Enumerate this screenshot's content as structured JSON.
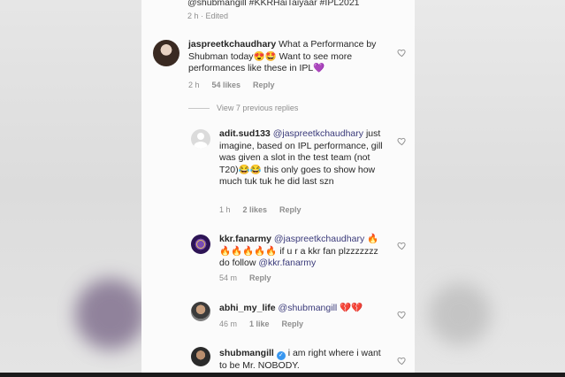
{
  "top": {
    "caption_tail": "@shubmangill #KKRHaiTaiyaar #IPL2021",
    "meta": "2 h · Edited"
  },
  "comments": [
    {
      "username": "jaspreetkchaudhary",
      "text": "What a Performance by Shubman today😍🤩 Want to see more performances like these in IPL💜",
      "time": "2 h",
      "likes": "54 likes",
      "reply": "Reply"
    }
  ],
  "view_previous": "View 7 previous replies",
  "replies": [
    {
      "username": "adit.sud133",
      "mention": "@jaspreetkchaudhary",
      "text": "just imagine, based on IPL performance, gill was given a slot in the test team (not T20)😂😂 this only goes to show how much tuk tuk he did last szn",
      "time": "1 h",
      "likes": "2 likes",
      "reply": "Reply"
    },
    {
      "username": "kkr.fanarmy",
      "mention": "@jaspreetkchaudhary",
      "text": "🔥🔥🔥🔥🔥🔥 if u r a kkr fan plzzzzzzz do follow",
      "mention2": "@kkr.fanarmy",
      "time": "54 m",
      "reply": "Reply"
    },
    {
      "username": "abhi_my_life",
      "mention": "@shubmangill",
      "text": "💔💔",
      "time": "46 m",
      "likes": "1 like",
      "reply": "Reply"
    },
    {
      "username": "shubmangill",
      "text": "i am right where i want to be Mr. NOBODY."
    }
  ],
  "colors": {
    "text": "#262626",
    "secondary": "#8e8e8e",
    "verified": "#3897f0"
  }
}
